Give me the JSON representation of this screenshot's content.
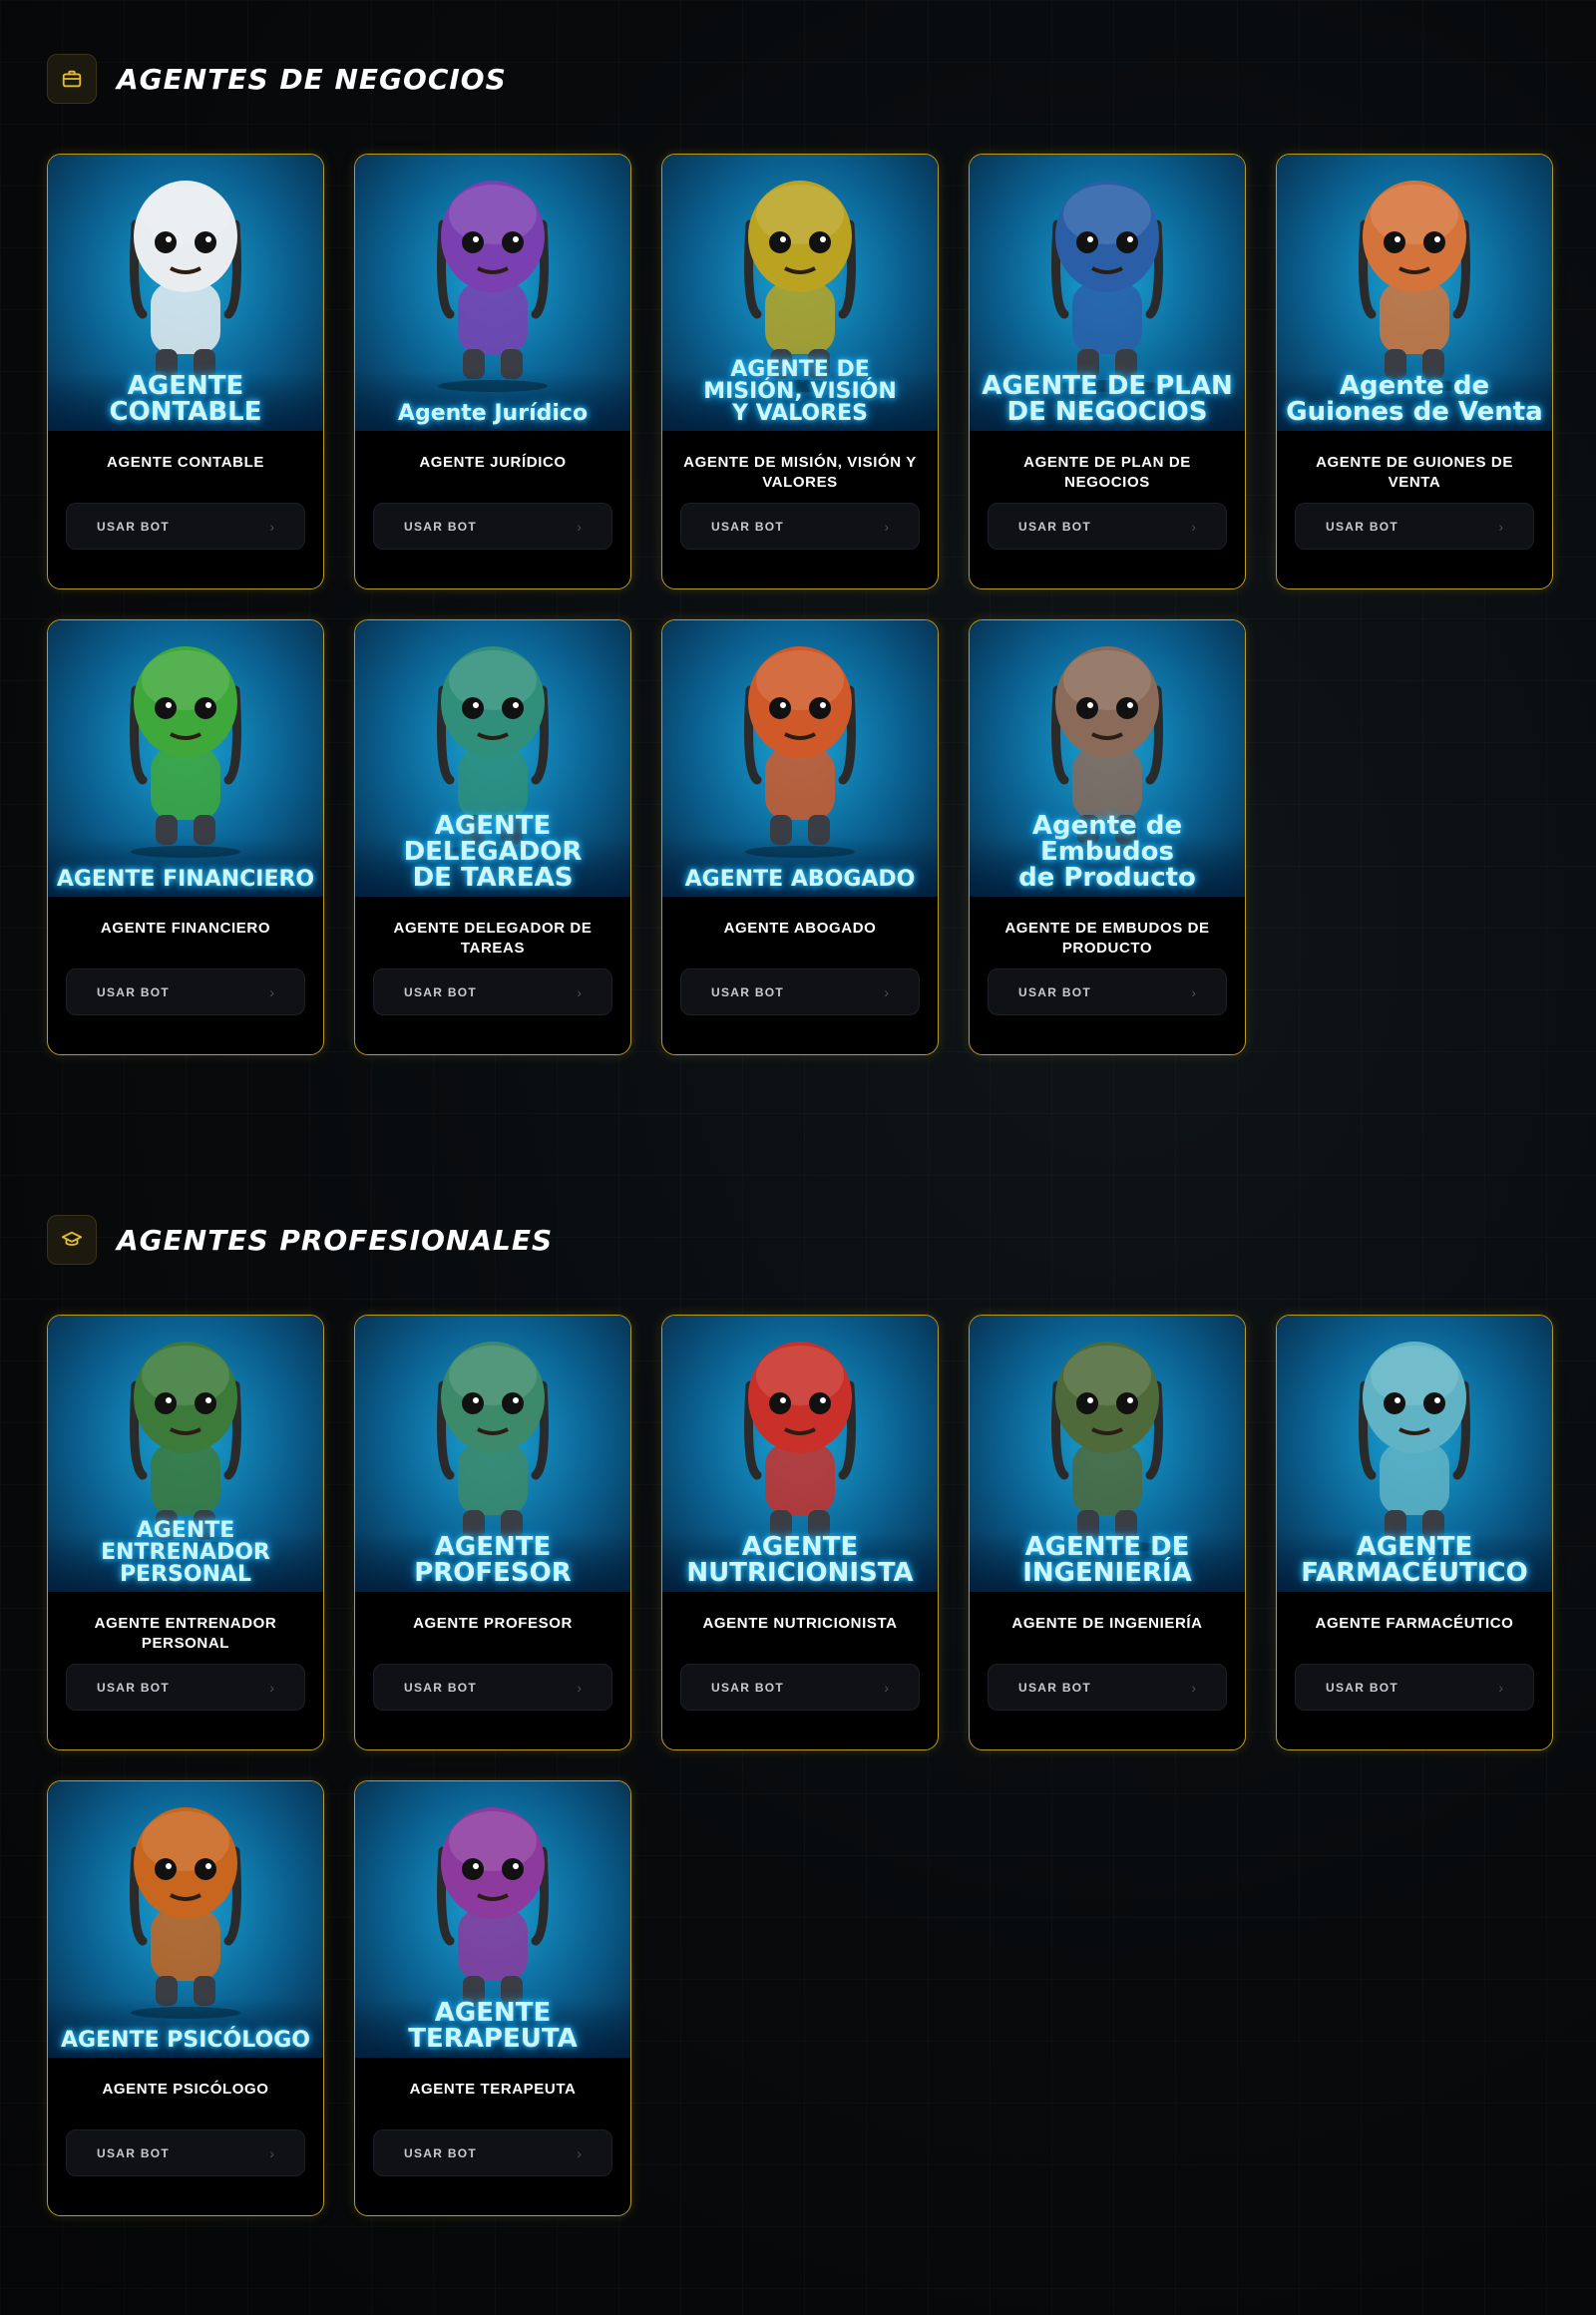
{
  "sections": [
    {
      "title": "AGENTES DE NEGOCIOS",
      "icon": "briefcase-icon",
      "cards": [
        {
          "name": "AGENTE CONTABLE",
          "art": "AGENTE\nCONTABLE",
          "accent": "#e9edf0"
        },
        {
          "name": "AGENTE JURÍDICO",
          "art": "Agente Jurídico",
          "accent": "#7a3fb0"
        },
        {
          "name": "AGENTE DE MISIÓN, VISIÓN Y VALORES",
          "art": "AGENTE DE\nMISIÓN, VISIÓN\nY VALORES",
          "accent": "#b9a321"
        },
        {
          "name": "AGENTE DE PLAN DE NEGOCIOS",
          "art": "AGENTE DE PLAN\nDE NEGOCIOS",
          "accent": "#2a5fa8"
        },
        {
          "name": "AGENTE DE GUIONES DE VENTA",
          "art": "Agente de\nGuiones de Venta",
          "accent": "#d4743a"
        },
        {
          "name": "AGENTE FINANCIERO",
          "art": "AGENTE FINANCIERO",
          "accent": "#3fa83a"
        },
        {
          "name": "AGENTE DELEGADOR DE TAREAS",
          "art": "AGENTE DELEGADOR\nDE TAREAS",
          "accent": "#2f8f7a"
        },
        {
          "name": "AGENTE ABOGADO",
          "art": "AGENTE ABOGADO",
          "accent": "#d0592a"
        },
        {
          "name": "AGENTE DE EMBUDOS DE PRODUCTO",
          "art": "Agente de Embudos\nde Producto",
          "accent": "#8a6a58"
        }
      ]
    },
    {
      "title": "AGENTES PROFESIONALES",
      "icon": "graduation-cap-icon",
      "cards": [
        {
          "name": "AGENTE ENTRENADOR PERSONAL",
          "art": "AGENTE\nENTRENADOR\nPERSONAL",
          "accent": "#3c7a3a"
        },
        {
          "name": "AGENTE PROFESOR",
          "art": "AGENTE\nPROFESOR",
          "accent": "#3c8a6a"
        },
        {
          "name": "AGENTE NUTRICIONISTA",
          "art": "AGENTE\nNUTRICIONISTA",
          "accent": "#c9302a"
        },
        {
          "name": "AGENTE DE INGENIERÍA",
          "art": "AGENTE DE\nINGENIERÍA",
          "accent": "#4f6a3a"
        },
        {
          "name": "AGENTE FARMACÉUTICO",
          "art": "AGENTE\nFARMACÉUTICO",
          "accent": "#5fb3c4"
        },
        {
          "name": "AGENTE PSICÓLOGO",
          "art": "AGENTE PSICÓLOGO",
          "accent": "#c8651e"
        },
        {
          "name": "AGENTE TERAPEUTA",
          "art": "AGENTE\nTERAPEUTA",
          "accent": "#8c3a9e"
        }
      ]
    }
  ],
  "button_label": "USAR BOT",
  "button_chevron": "›",
  "colors": {
    "border": "#b89a1e",
    "icon": "#e2bd2a",
    "background": "#080a0c"
  }
}
